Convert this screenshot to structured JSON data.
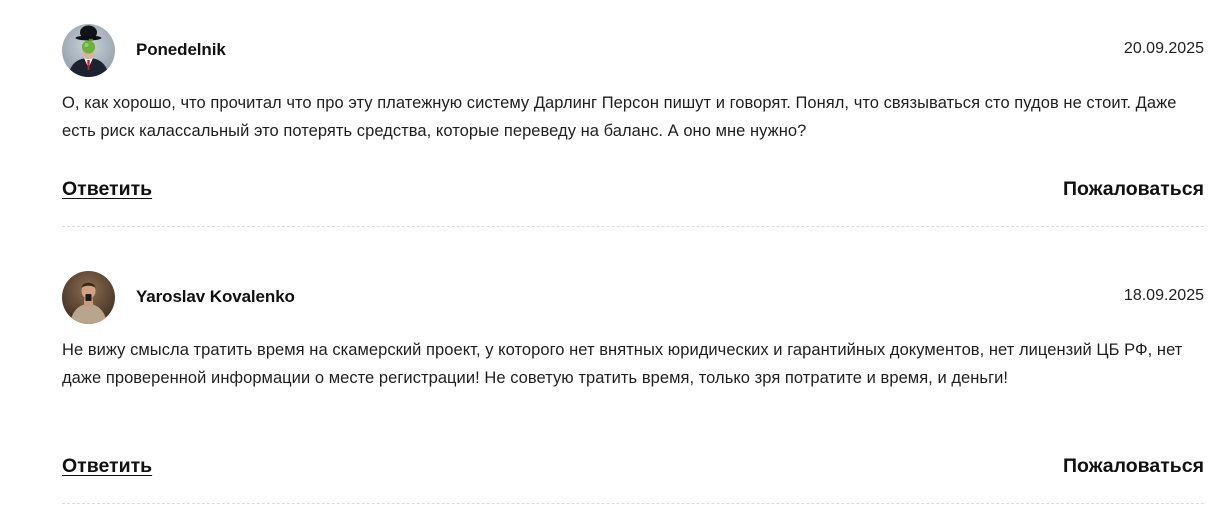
{
  "comments": [
    {
      "author": "Ponedelnik",
      "date": "20.09.2025",
      "text": "О, как хорошо, что прочитал что про эту платежную систему Дарлинг Персон пишут и говорят. Понял, что связываться сто пудов не стоит. Даже есть риск калассальный это потерять средства, которые переведу на баланс. А оно мне нужно?",
      "reply_label": "Ответить",
      "report_label": "Пожаловаться",
      "avatar_icon": "man-bowler-hat-apple-avatar"
    },
    {
      "author": "Yaroslav Kovalenko",
      "date": "18.09.2025",
      "text": "Не вижу смысла тратить время на скамерский проект, у которого нет внятных юридических и гарантийных документов, нет лицензий ЦБ РФ, нет даже проверенной информации о месте регистрации! Не советую тратить время, только зря потратите и время, и деньги!",
      "reply_label": "Ответить",
      "report_label": "Пожаловаться",
      "avatar_icon": "man-mirror-selfie-avatar"
    }
  ],
  "colors": {
    "text": "#1f1f1f",
    "divider": "#dcdcdc",
    "background": "#ffffff"
  }
}
